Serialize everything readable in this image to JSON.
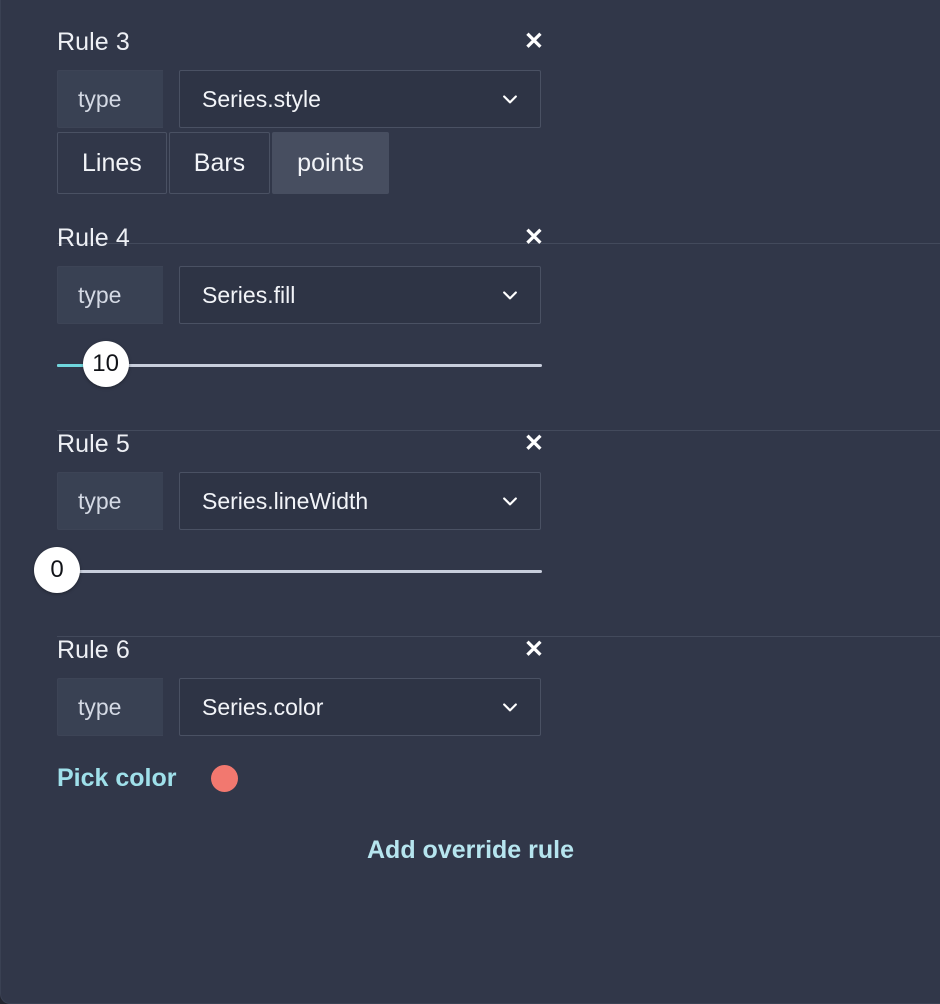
{
  "panel": {
    "background_color": "#313749",
    "accent_color": "#9fe0ea"
  },
  "rules": [
    {
      "title": "Rule 3",
      "close_label": "✕",
      "type_label": "type",
      "select_value": "Series.style",
      "control": "segmented",
      "segments": [
        {
          "label": "Lines",
          "selected": false
        },
        {
          "label": "Bars",
          "selected": false
        },
        {
          "label": "points",
          "selected": true
        }
      ]
    },
    {
      "title": "Rule 4",
      "close_label": "✕",
      "type_label": "type",
      "select_value": "Series.fill",
      "control": "slider",
      "slider_value": "10",
      "slider_percent": 10
    },
    {
      "title": "Rule 5",
      "close_label": "✕",
      "type_label": "type",
      "select_value": "Series.lineWidth",
      "control": "slider",
      "slider_value": "0",
      "slider_percent": 0
    },
    {
      "title": "Rule 6",
      "close_label": "✕",
      "type_label": "type",
      "select_value": "Series.color",
      "control": "color",
      "pick_color_label": "Pick color",
      "swatch_color": "#f2786f"
    }
  ],
  "footer": {
    "add_rule_label": "Add override rule"
  }
}
